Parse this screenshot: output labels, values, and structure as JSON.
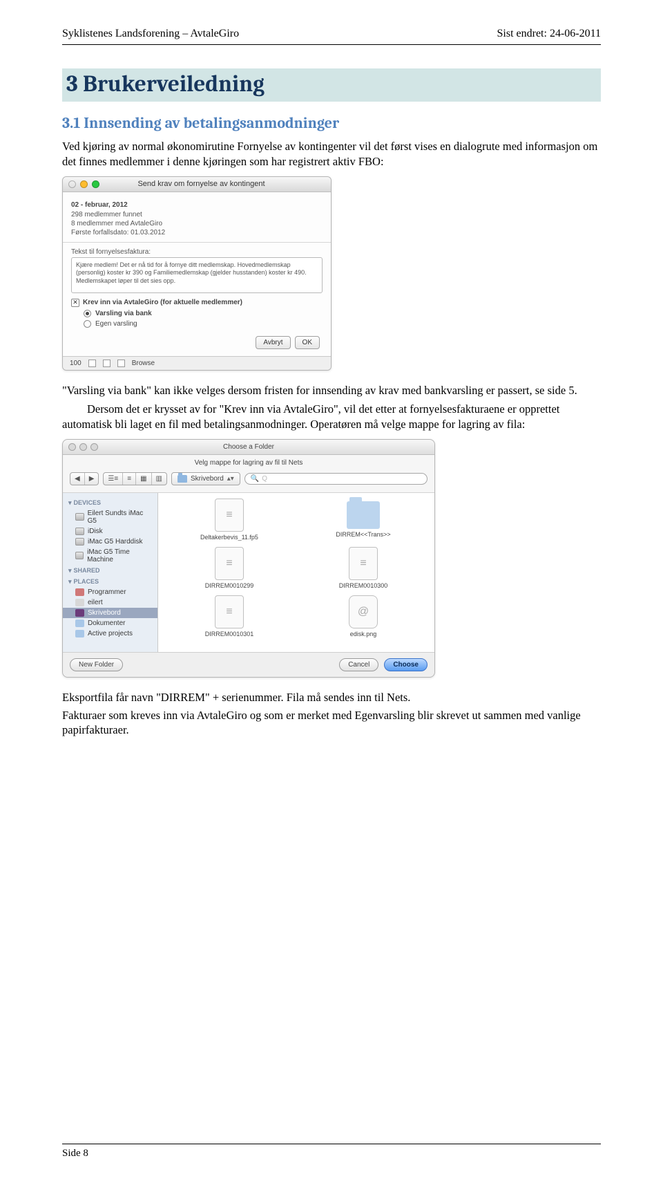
{
  "header": {
    "left": "Syklistenes Landsforening – AvtaleGiro",
    "right": "Sist endret: 24-06-2011"
  },
  "h1": "3 Brukerveiledning",
  "h2": "3.1 Innsending av betalingsanmodninger",
  "para1": "Ved kjøring av normal økonomirutine Fornyelse av kontingenter vil det først vises en dialogrute med informasjon om det finnes medlemmer i denne kjøringen som har registrert aktiv FBO:",
  "dialog1": {
    "title": "Send krav om fornyelse av kontingent",
    "date_line": "02 - februar, 2012",
    "found_line": "298 medlemmer funnet",
    "avtale_line": "8 medlemmer med AvtaleGiro",
    "due_line": "Første forfallsdato: 01.03.2012",
    "textarea_label": "Tekst til fornyelsesfaktura:",
    "textarea_text": "Kjære medlem! Det er nå tid for å fornye ditt medlemskap.\nHovedmedlemskap (personlig) koster kr 390 og Familiemedlemskap (gjelder husstanden) koster kr 490. Medlemskapet løper til det sies opp.",
    "checkbox": "Krev inn via AvtaleGiro (for aktuelle medlemmer)",
    "radio1": "Varsling via bank",
    "radio2": "Egen varsling",
    "btn_cancel": "Avbryt",
    "btn_ok": "OK",
    "status_num": "100",
    "status_browse": "Browse"
  },
  "para2": "\"Varsling via bank\" kan ikke velges dersom fristen for innsending av krav med bankvarsling er passert, se side 5.",
  "para3a": "Dersom det er krysset av for \"Krev inn via AvtaleGiro\", vil det etter at fornyelsesfakturaene er opprettet automatisk bli laget en fil med betalingsanmodninger. Operatøren må velge mappe for lagring av fila:",
  "dialog2": {
    "titlebar": "Choose a Folder",
    "subtitle": "Velg mappe for lagring av fil til Nets",
    "back": "◀",
    "fwd": "▶",
    "view1": "☰≡",
    "view2": "≡",
    "view3": "▦",
    "view4": "▥",
    "folder_sel": "Skrivebord",
    "search_placeholder": "Q",
    "sidebar": {
      "devices": "DEVICES",
      "dev_items": [
        "Eilert Sundts iMac G5",
        "iDisk",
        "iMac G5 Harddisk",
        "iMac G5 Time Machine"
      ],
      "shared": "SHARED",
      "places": "PLACES",
      "place_items": [
        "Programmer",
        "eilert",
        "Skrivebord",
        "Dokumenter",
        "Active projects"
      ]
    },
    "files": [
      {
        "name": "Deltakerbevis_11.fp5",
        "type": "doc"
      },
      {
        "name": "DIRREM<<Trans>>",
        "type": "folder"
      },
      {
        "name": "DIRREM0010299",
        "type": "doc"
      },
      {
        "name": "DIRREM0010300",
        "type": "doc"
      },
      {
        "name": "DIRREM0010301",
        "type": "doc"
      },
      {
        "name": "edisk.png",
        "type": "at"
      }
    ],
    "new_folder": "New Folder",
    "cancel": "Cancel",
    "choose": "Choose"
  },
  "para4": "Eksportfila får navn \"DIRREM\" + serienummer. Fila må sendes inn til Nets.",
  "para5": "Fakturaer som kreves inn via AvtaleGiro og som er merket med Egenvarsling blir skrevet ut sammen med vanlige papirfakturaer.",
  "footer": "Side 8",
  "colors": {
    "red": "#ff5f57",
    "yellow": "#febc2e",
    "green": "#28c840"
  },
  "chart_data": null
}
